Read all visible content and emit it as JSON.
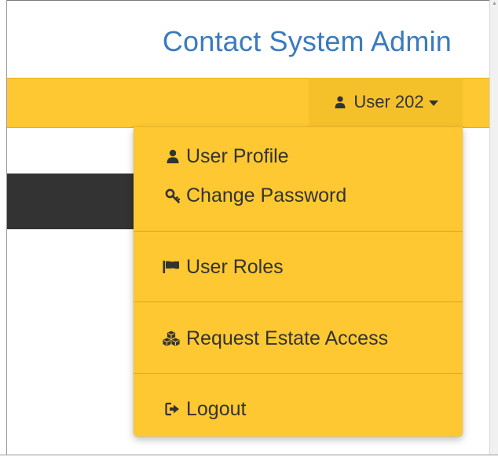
{
  "header": {
    "title": "Contact System Admin"
  },
  "user_menu": {
    "toggle_label": "User 202",
    "toggle_icon": "user-icon",
    "items": [
      {
        "label": "User Profile",
        "icon": "user-icon"
      },
      {
        "label": "Change Password",
        "icon": "key-icon"
      },
      {
        "label": "User Roles",
        "icon": "flag-icon"
      },
      {
        "label": "Request Estate Access",
        "icon": "cubes-icon"
      },
      {
        "label": "Logout",
        "icon": "sign-out-icon"
      }
    ]
  },
  "colors": {
    "accent_yellow": "#fdc831",
    "title_blue": "#3a7bbf",
    "text_dark": "#333333",
    "dark_band": "#333333"
  }
}
